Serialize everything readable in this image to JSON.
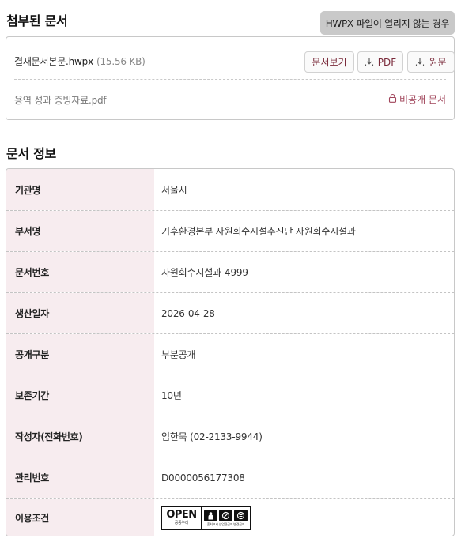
{
  "attachments": {
    "title": "첨부된 문서",
    "hwpx_help_label": "HWPX 파일이 열리지 않는 경우",
    "files": [
      {
        "name": "결재문서본문.hwpx",
        "size": "(15.56 KB)",
        "actions": {
          "view": "문서보기",
          "pdf": "PDF",
          "original": "원문"
        }
      },
      {
        "name": "용역 성과 증빙자료.pdf",
        "status": "비공개 문서"
      }
    ]
  },
  "doc_info": {
    "title": "문서 정보",
    "rows": [
      {
        "label": "기관명",
        "value": "서울시"
      },
      {
        "label": "부서명",
        "value": "기후환경본부 자원회수시설추진단 자원회수시설과"
      },
      {
        "label": "문서번호",
        "value": "자원회수시설과-4999"
      },
      {
        "label": "생산일자",
        "value": "2026-04-28"
      },
      {
        "label": "공개구분",
        "value": "부분공개"
      },
      {
        "label": "보존기간",
        "value": "10년"
      },
      {
        "label": "작성자(전화번호)",
        "value": "임한묵 (02-2133-9944)"
      },
      {
        "label": "관리번호",
        "value": "D0000056177308"
      },
      {
        "label": "이용조건",
        "value": ""
      }
    ],
    "license": {
      "open_text": "OPEN",
      "open_caption": "공공누리",
      "icons": [
        "attribution-icon",
        "noncommercial-icon",
        "no-derivatives-icon"
      ],
      "caption": "출처표시 상업용금지 변경금지"
    }
  },
  "colors": {
    "label_bg": "#f7ecef",
    "accent": "#7a2a3a",
    "private": "#a0445a",
    "help_button_bg": "#c9c9c9"
  }
}
